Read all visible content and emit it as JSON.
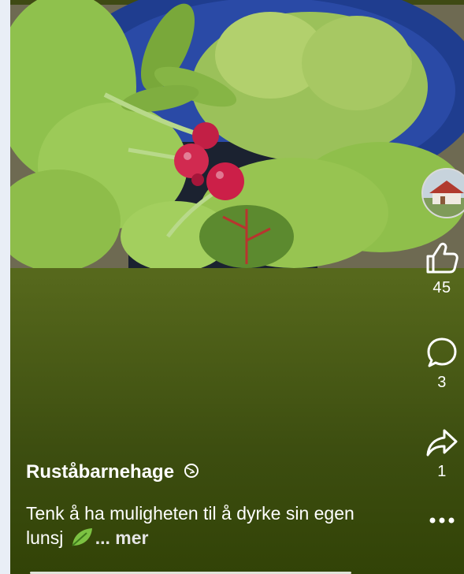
{
  "post": {
    "author": "Ruståbarnehage",
    "caption": "Tenk å ha muligheten til å dyrke sin egen lunsj",
    "more_label": "... mer"
  },
  "actions": {
    "likes": "45",
    "comments": "3",
    "shares": "1"
  },
  "icons": {
    "like": "thumbs-up-icon",
    "comment": "comment-bubble-icon",
    "share": "share-arrow-icon",
    "more": "more-dots-icon",
    "privacy": "globe-icon",
    "emoji": "leaf-emoji-icon"
  },
  "colors": {
    "overlay_green": "#56681c",
    "text": "#ffffff"
  }
}
